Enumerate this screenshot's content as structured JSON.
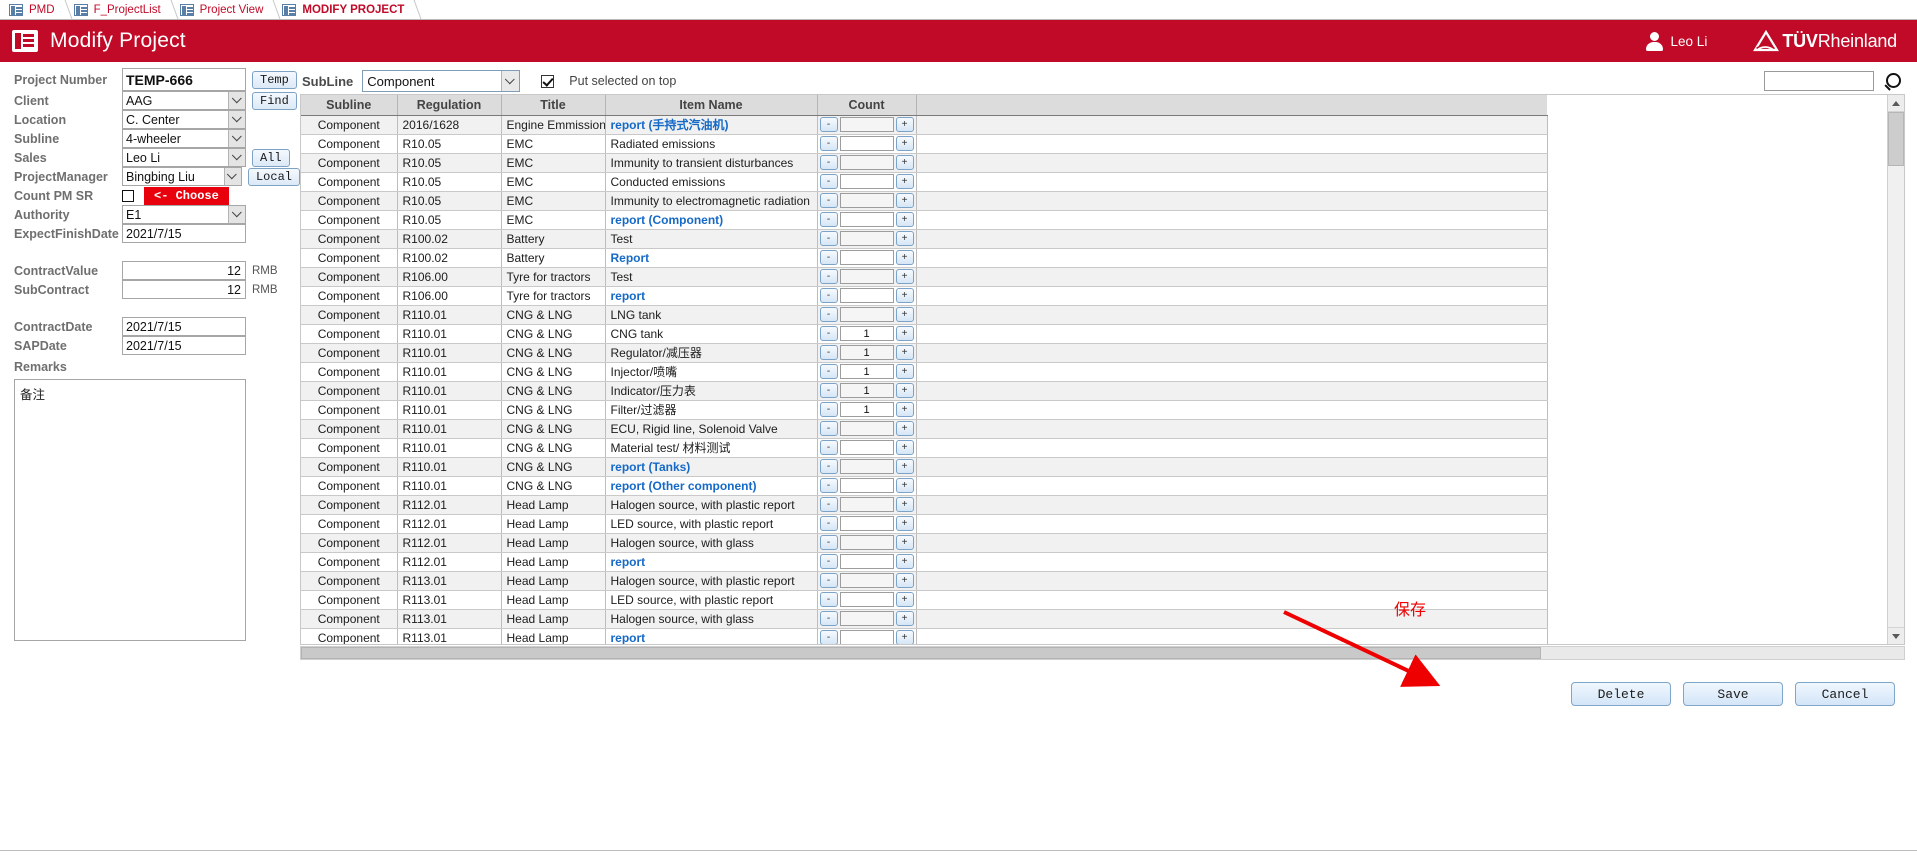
{
  "tabs": [
    {
      "label": "PMD",
      "active": false
    },
    {
      "label": "F_ProjectList",
      "active": false
    },
    {
      "label": "Project View",
      "active": false
    },
    {
      "label": "MODIFY PROJECT",
      "active": true
    }
  ],
  "header": {
    "title": "Modify Project",
    "icon": "form-icon",
    "user_name": "Leo Li",
    "user_icon": "user-avatar-icon",
    "brand_text_bold": "TÜV",
    "brand_text_rest": "Rheinland",
    "brand_icon": "tuv-triangle-icon",
    "accent_color": "#c00a27"
  },
  "form": {
    "project_number": {
      "label": "Project Number",
      "value": "TEMP-666"
    },
    "client": {
      "label": "Client",
      "value": "AAG"
    },
    "location": {
      "label": "Location",
      "value": "C. Center"
    },
    "subline": {
      "label": "Subline",
      "value": "4-wheeler"
    },
    "sales": {
      "label": "Sales",
      "value": "Leo Li"
    },
    "project_manager": {
      "label": "ProjectManager",
      "value": "Bingbing Liu"
    },
    "count_pm_sr": {
      "label": "Count PM SR",
      "checked": false
    },
    "authority": {
      "label": "Authority",
      "value": "E1"
    },
    "expect_finish_date": {
      "label": "ExpectFinishDate",
      "value": "2021/7/15"
    },
    "contract_value": {
      "label": "ContractValue",
      "value": "12",
      "unit": "RMB"
    },
    "sub_contract": {
      "label": "SubContract",
      "value": "12",
      "unit": "RMB"
    },
    "contract_date": {
      "label": "ContractDate",
      "value": "2021/7/15"
    },
    "sap_date": {
      "label": "SAPDate",
      "value": "2021/7/15"
    },
    "remarks": {
      "label": "Remarks",
      "value": "备注"
    },
    "buttons": {
      "temp": "Temp",
      "find": "Find",
      "all": "All",
      "local": "Local",
      "choose": "<- Choose"
    }
  },
  "toolbar": {
    "subline_label": "SubLine",
    "subline_value": "Component",
    "put_selected_label": "Put selected on top",
    "put_selected_checked": true,
    "search_value": "",
    "search_placeholder": ""
  },
  "table": {
    "columns": [
      "Subline",
      "Regulation",
      "Title",
      "Item Name",
      "Count"
    ],
    "rows": [
      {
        "subline": "Component",
        "regulation": "2016/1628",
        "title": "Engine Emmission",
        "item": "report (手持式汽油机)",
        "link": true,
        "count": ""
      },
      {
        "subline": "Component",
        "regulation": "R10.05",
        "title": "EMC",
        "item": "Radiated emissions",
        "link": false,
        "count": ""
      },
      {
        "subline": "Component",
        "regulation": "R10.05",
        "title": "EMC",
        "item": "Immunity to transient disturbances",
        "link": false,
        "count": ""
      },
      {
        "subline": "Component",
        "regulation": "R10.05",
        "title": "EMC",
        "item": "Conducted emissions",
        "link": false,
        "count": ""
      },
      {
        "subline": "Component",
        "regulation": "R10.05",
        "title": "EMC",
        "item": "Immunity to electromagnetic radiation",
        "link": false,
        "count": ""
      },
      {
        "subline": "Component",
        "regulation": "R10.05",
        "title": "EMC",
        "item": "report (Component)",
        "link": true,
        "count": ""
      },
      {
        "subline": "Component",
        "regulation": "R100.02",
        "title": "Battery",
        "item": "Test",
        "link": false,
        "count": ""
      },
      {
        "subline": "Component",
        "regulation": "R100.02",
        "title": "Battery",
        "item": "Report",
        "link": true,
        "count": ""
      },
      {
        "subline": "Component",
        "regulation": "R106.00",
        "title": "Tyre for tractors",
        "item": "Test",
        "link": false,
        "count": ""
      },
      {
        "subline": "Component",
        "regulation": "R106.00",
        "title": "Tyre for tractors",
        "item": "report",
        "link": true,
        "count": ""
      },
      {
        "subline": "Component",
        "regulation": "R110.01",
        "title": "CNG & LNG",
        "item": "LNG tank",
        "link": false,
        "count": ""
      },
      {
        "subline": "Component",
        "regulation": "R110.01",
        "title": "CNG & LNG",
        "item": "CNG tank",
        "link": false,
        "count": "1"
      },
      {
        "subline": "Component",
        "regulation": "R110.01",
        "title": "CNG & LNG",
        "item": "Regulator/减压器",
        "link": false,
        "count": "1"
      },
      {
        "subline": "Component",
        "regulation": "R110.01",
        "title": "CNG & LNG",
        "item": "Injector/喷嘴",
        "link": false,
        "count": "1"
      },
      {
        "subline": "Component",
        "regulation": "R110.01",
        "title": "CNG & LNG",
        "item": "Indicator/压力表",
        "link": false,
        "count": "1"
      },
      {
        "subline": "Component",
        "regulation": "R110.01",
        "title": "CNG & LNG",
        "item": "Filter/过滤器",
        "link": false,
        "count": "1"
      },
      {
        "subline": "Component",
        "regulation": "R110.01",
        "title": "CNG & LNG",
        "item": "ECU, Rigid line, Solenoid Valve",
        "link": false,
        "count": ""
      },
      {
        "subline": "Component",
        "regulation": "R110.01",
        "title": "CNG & LNG",
        "item": "Material test/ 材料测试",
        "link": false,
        "count": ""
      },
      {
        "subline": "Component",
        "regulation": "R110.01",
        "title": "CNG & LNG",
        "item": "report (Tanks)",
        "link": true,
        "count": ""
      },
      {
        "subline": "Component",
        "regulation": "R110.01",
        "title": "CNG & LNG",
        "item": "report (Other component)",
        "link": true,
        "count": ""
      },
      {
        "subline": "Component",
        "regulation": "R112.01",
        "title": "Head Lamp",
        "item": "Halogen source, with plastic report",
        "link": false,
        "count": ""
      },
      {
        "subline": "Component",
        "regulation": "R112.01",
        "title": "Head Lamp",
        "item": "LED source, with plastic report",
        "link": false,
        "count": ""
      },
      {
        "subline": "Component",
        "regulation": "R112.01",
        "title": "Head Lamp",
        "item": "Halogen source, with glass",
        "link": false,
        "count": ""
      },
      {
        "subline": "Component",
        "regulation": "R112.01",
        "title": "Head Lamp",
        "item": "report",
        "link": true,
        "count": ""
      },
      {
        "subline": "Component",
        "regulation": "R113.01",
        "title": "Head Lamp",
        "item": "Halogen source, with plastic report",
        "link": false,
        "count": ""
      },
      {
        "subline": "Component",
        "regulation": "R113.01",
        "title": "Head Lamp",
        "item": "LED source, with plastic report",
        "link": false,
        "count": ""
      },
      {
        "subline": "Component",
        "regulation": "R113.01",
        "title": "Head Lamp",
        "item": "Halogen source, with glass",
        "link": false,
        "count": ""
      },
      {
        "subline": "Component",
        "regulation": "R113.01",
        "title": "Head Lamp",
        "item": "report",
        "link": true,
        "count": ""
      }
    ],
    "spinner_minus": "-",
    "spinner_plus": "+"
  },
  "footer": {
    "delete_label": "Delete",
    "save_label": "Save",
    "cancel_label": "Cancel"
  },
  "annotation": {
    "text": "保存",
    "color": "#ee0000"
  }
}
